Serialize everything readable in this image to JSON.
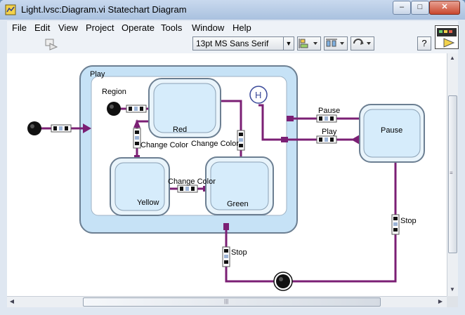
{
  "window": {
    "title": "Light.lvsc:Diagram.vi Statechart Diagram",
    "controls": {
      "minimize": "–",
      "maximize": "□",
      "close": "✕"
    }
  },
  "menu": [
    {
      "label": "File"
    },
    {
      "label": "Edit"
    },
    {
      "label": "View"
    },
    {
      "label": "Project"
    },
    {
      "label": "Operate"
    },
    {
      "label": "Tools"
    },
    {
      "label": "Window"
    },
    {
      "label": "Help"
    }
  ],
  "toolbar": {
    "font_value": "13pt MS Sans Serif",
    "help_label": "?"
  },
  "diagram": {
    "superstate_label": "Play",
    "region_label": "Region",
    "history_label": "H",
    "states": {
      "red": "Red",
      "yellow": "Yellow",
      "green": "Green",
      "pause": "Pause"
    },
    "transitions": {
      "red_to_green": "Change Color",
      "green_to_yellow": "Change Color",
      "yellow_to_red": "Change Color",
      "pause": "Pause",
      "play": "Play",
      "stop_play": "Stop",
      "stop_pause": "Stop"
    }
  },
  "colors": {
    "wire": "#7b1f74",
    "state_fill": "#d6ecfb",
    "state_border": "#6c7f92",
    "superstate_outer": "#cfe6f7"
  }
}
